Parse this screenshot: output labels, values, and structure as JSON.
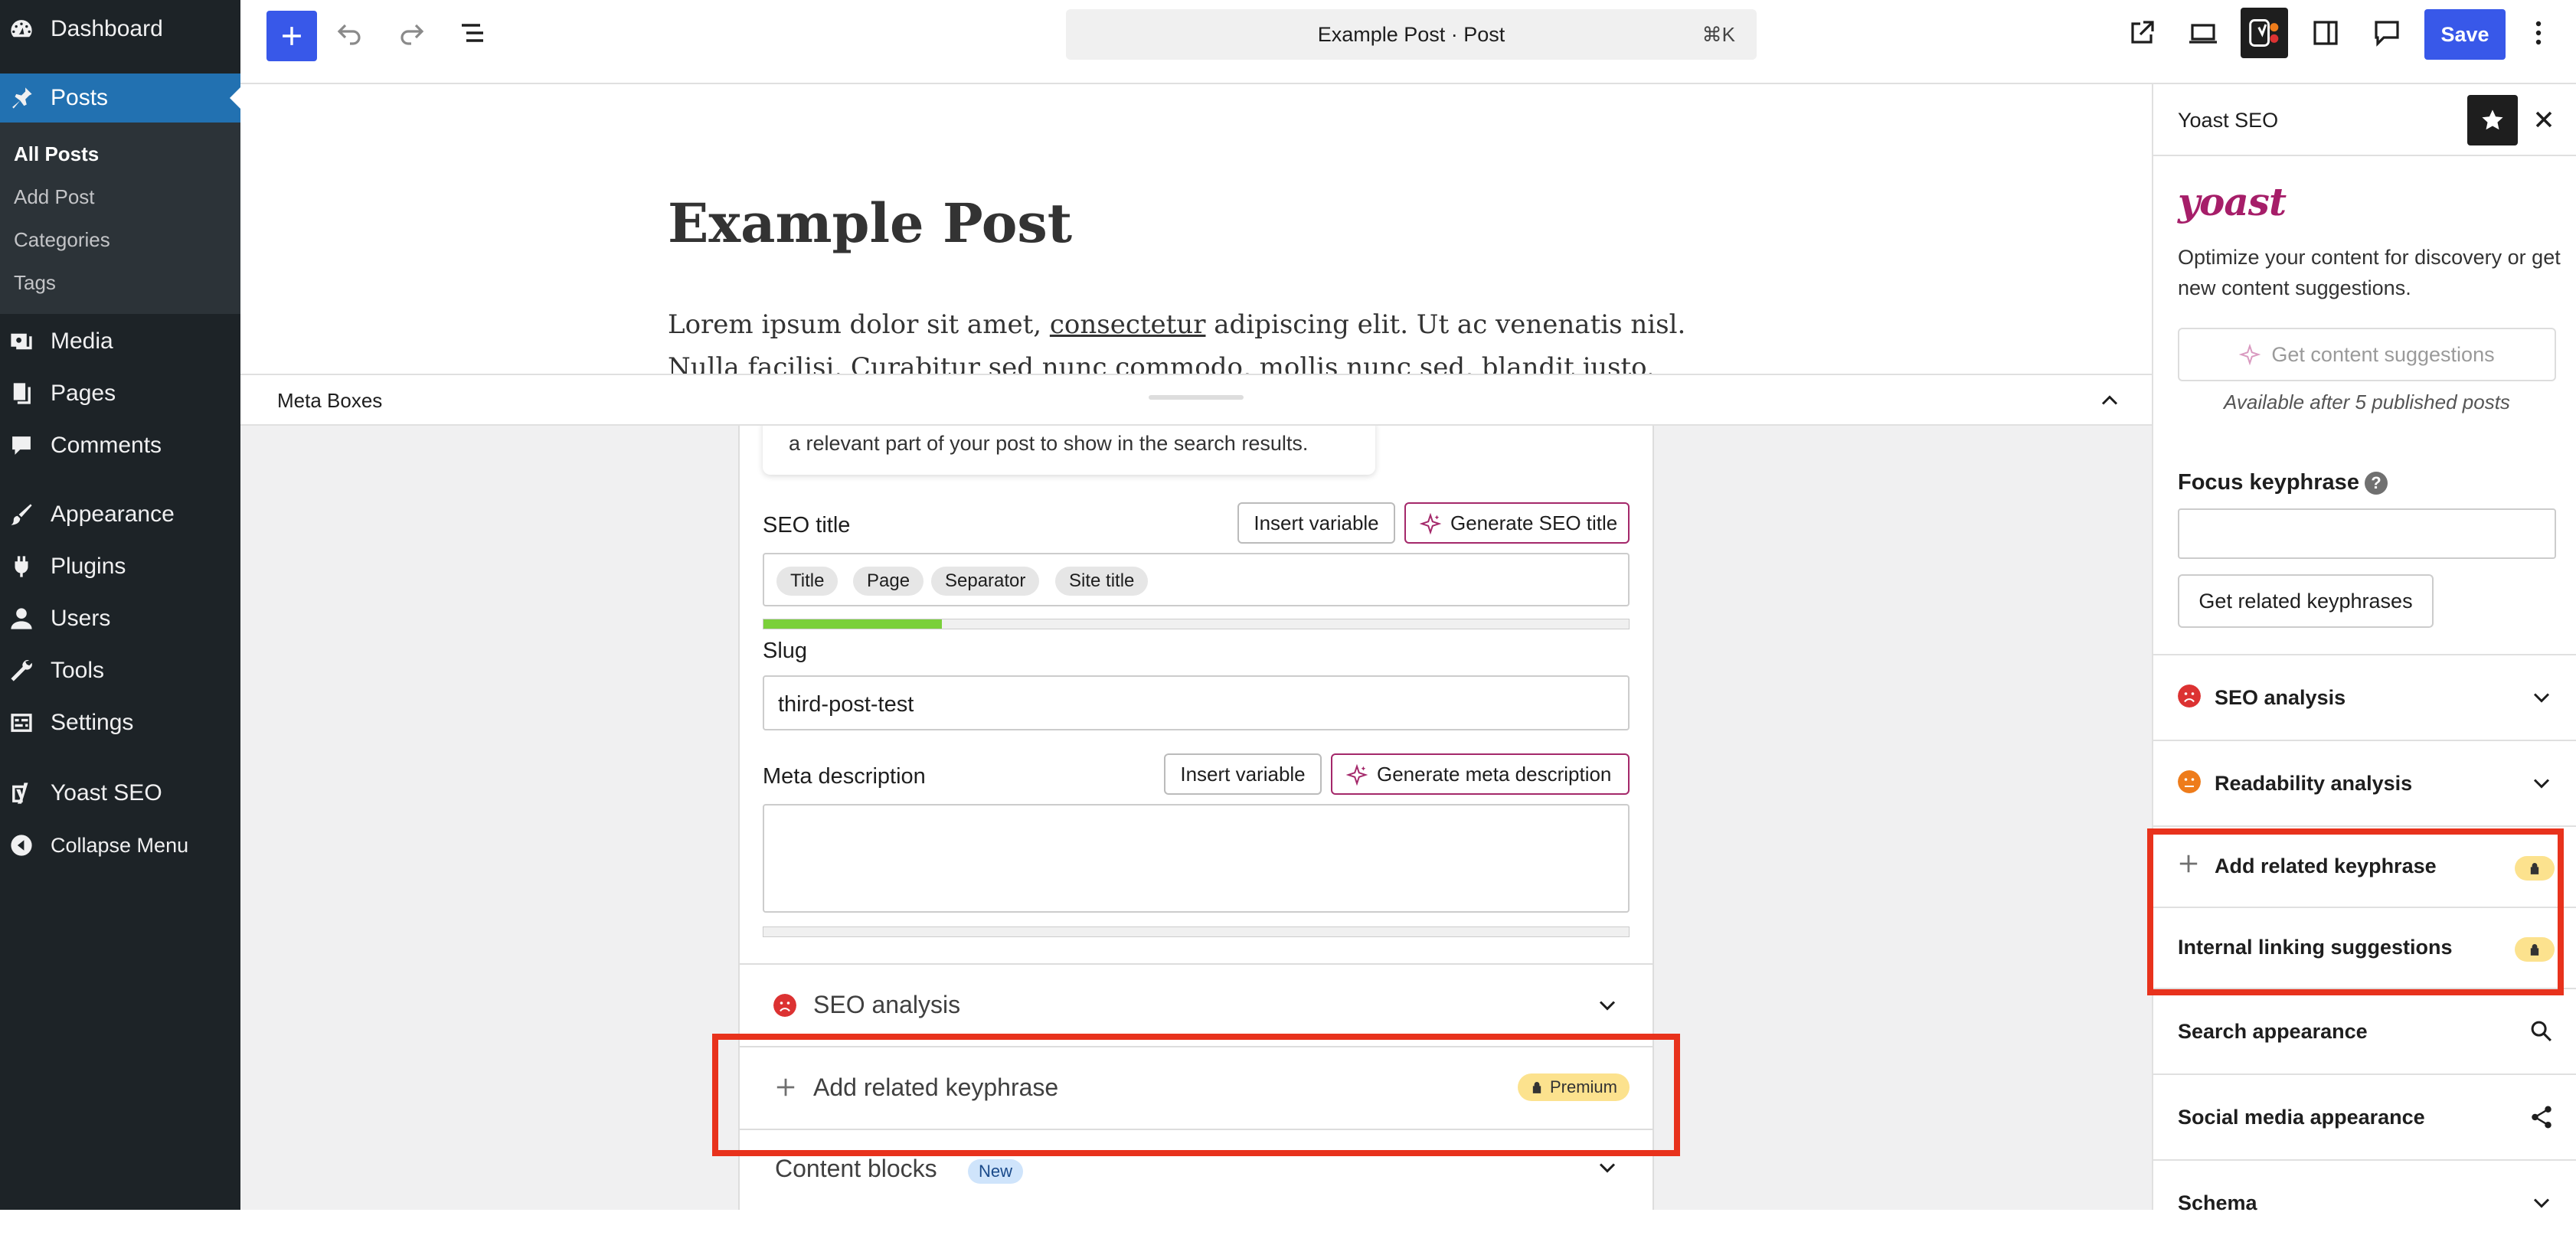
{
  "admin_menu": {
    "dashboard": "Dashboard",
    "posts": "Posts",
    "posts_submenu": [
      "All Posts",
      "Add Post",
      "Categories",
      "Tags"
    ],
    "media": "Media",
    "pages": "Pages",
    "comments": "Comments",
    "appearance": "Appearance",
    "plugins": "Plugins",
    "users": "Users",
    "tools": "Tools",
    "settings": "Settings",
    "yoast": "Yoast SEO",
    "collapse": "Collapse Menu"
  },
  "toolbar": {
    "document_title": "Example Post · Post",
    "shortcut": "⌘K",
    "save_label": "Save"
  },
  "post": {
    "title": "Example Post",
    "body_before": "Lorem ipsum dolor sit amet, ",
    "body_link": "consectetur",
    "body_after": " adipiscing elit. Ut ac venenatis nisl. Nulla facilisi. Curabitur sed nunc commodo, mollis nunc sed, blandit justo. Nulla eget"
  },
  "meta_boxes": {
    "label": "Meta Boxes",
    "tip_text": "a relevant part of your post to show in the search results.",
    "seo_title_label": "SEO title",
    "insert_variable": "Insert variable",
    "generate_seo_title": "Generate SEO title",
    "title_pills": [
      "Title",
      "Page",
      "Separator",
      "Site title"
    ],
    "title_progress": 0.206,
    "slug_label": "Slug",
    "slug_value": "third-post-test",
    "meta_description_label": "Meta description",
    "generate_meta_description": "Generate meta description",
    "meta_description_progress": 0,
    "seo_analysis": "SEO analysis",
    "add_related_keyphrase": "Add related keyphrase",
    "premium_badge": "Premium",
    "content_blocks": "Content blocks",
    "new_badge": "New"
  },
  "yoast_sidebar": {
    "title": "Yoast SEO",
    "logo": "yoast",
    "description": "Optimize your content for discovery or get new content suggestions.",
    "content_suggestions_btn": "Get content suggestions",
    "availability_note": "Available after 5 published posts",
    "focus_keyphrase_label": "Focus keyphrase",
    "focus_keyphrase_value": "",
    "related_keyphrases_btn": "Get related keyphrases",
    "seo_analysis": "SEO analysis",
    "readability_analysis": "Readability analysis",
    "add_related_keyphrase": "Add related keyphrase",
    "internal_linking": "Internal linking suggestions",
    "search_appearance": "Search appearance",
    "social_media_appearance": "Social media appearance",
    "schema": "Schema"
  },
  "colors": {
    "accent": "#3858e9",
    "admin_bg": "#1d2327",
    "admin_active": "#2271b1",
    "yoast_brand": "#a61e69",
    "highlight": "#e8321c",
    "premium_badge": "#fce28e",
    "seo_bad": "#dc3232",
    "readability_ok": "#ee7c1b",
    "progress_good": "#7ad03a"
  },
  "icons": {
    "dashboard": "dashboard-icon",
    "posts": "pushpin-icon",
    "media": "media-icon",
    "pages": "pages-icon",
    "comments": "comment-icon",
    "appearance": "paintbrush-icon",
    "plugins": "plugin-icon",
    "users": "user-icon",
    "tools": "wrench-icon",
    "settings": "settings-icon",
    "yoast": "yoast-icon",
    "collapse": "collapse-icon"
  }
}
